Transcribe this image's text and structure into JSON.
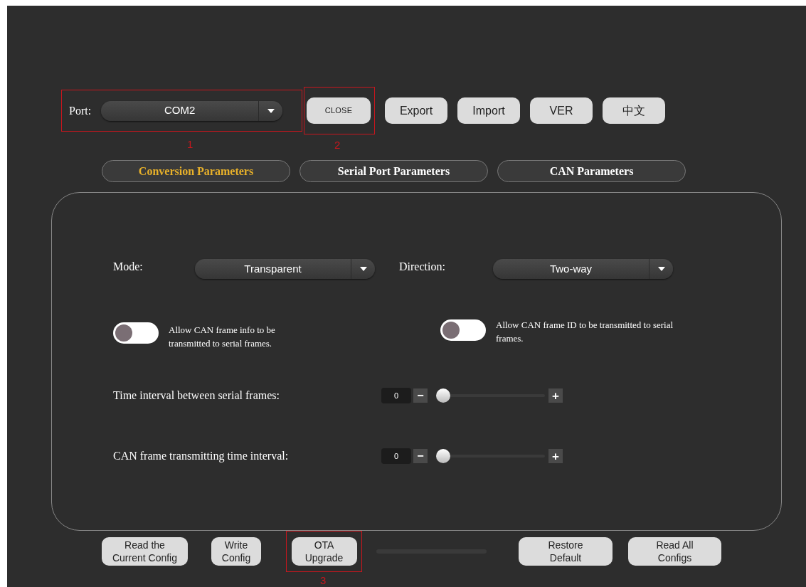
{
  "port": {
    "label": "Port:",
    "value": "COM2",
    "callout": "1"
  },
  "top_buttons": [
    {
      "label": "CLOSE",
      "kind": "small",
      "callout": "2"
    },
    {
      "label": "Export",
      "kind": "normal"
    },
    {
      "label": "Import",
      "kind": "normal"
    },
    {
      "label": "VER",
      "kind": "normal"
    },
    {
      "label": "中文",
      "kind": "normal"
    }
  ],
  "tabs": [
    {
      "label": "Conversion Parameters",
      "selected": true
    },
    {
      "label": "Serial Port Parameters",
      "selected": false
    },
    {
      "label": "CAN Parameters",
      "selected": false
    }
  ],
  "selects": [
    {
      "label": "Mode:",
      "value": "Transparent"
    },
    {
      "label": "Direction:",
      "value": "Two-way"
    }
  ],
  "toggles": [
    {
      "label": "Allow CAN frame info to be transmitted to serial frames.",
      "on": false
    },
    {
      "label": "Allow CAN frame ID to be transmitted to serial frames.",
      "on": false
    }
  ],
  "sliders": [
    {
      "label": "Time interval between serial frames:",
      "value": "0",
      "minus": "−",
      "plus": "+",
      "level": 0
    },
    {
      "label": "CAN frame transmitting time interval:",
      "value": "0",
      "minus": "−",
      "plus": "+",
      "level": 0
    }
  ],
  "bottom_buttons": [
    {
      "label": "Read the Current Config",
      "kind": "button"
    },
    {
      "label": "Write Config",
      "kind": "button"
    },
    {
      "label": "OTA Upgrade",
      "kind": "button",
      "callout": "3"
    },
    {
      "kind": "progress",
      "level": 0
    },
    {
      "label": "Restore Default",
      "kind": "button"
    },
    {
      "label": "Read All Configs",
      "kind": "button"
    }
  ]
}
